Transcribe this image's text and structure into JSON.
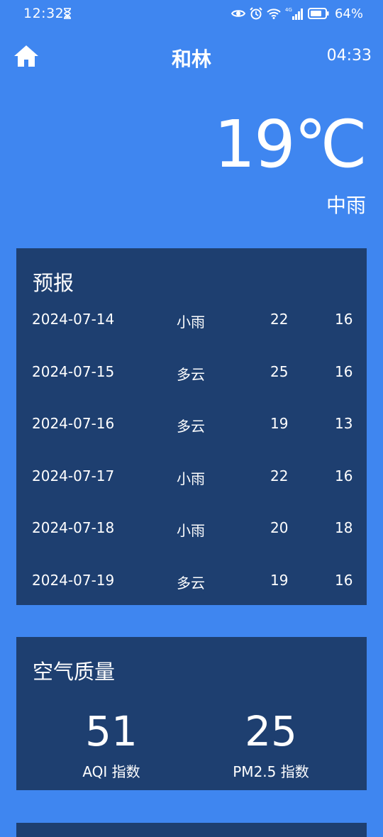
{
  "status_bar": {
    "time": "12:32",
    "battery_percent": "64%",
    "network_label": "4G"
  },
  "header": {
    "city": "和林",
    "update_time": "04:33"
  },
  "current": {
    "temperature": "19℃",
    "condition": "中雨"
  },
  "forecast": {
    "title": "预报",
    "rows": [
      {
        "date": "2024-07-14",
        "condition": "小雨",
        "max": "22",
        "min": "16"
      },
      {
        "date": "2024-07-15",
        "condition": "多云",
        "max": "25",
        "min": "16"
      },
      {
        "date": "2024-07-16",
        "condition": "多云",
        "max": "19",
        "min": "13"
      },
      {
        "date": "2024-07-17",
        "condition": "小雨",
        "max": "22",
        "min": "16"
      },
      {
        "date": "2024-07-18",
        "condition": "小雨",
        "max": "20",
        "min": "18"
      },
      {
        "date": "2024-07-19",
        "condition": "多云",
        "max": "19",
        "min": "16"
      }
    ]
  },
  "air_quality": {
    "title": "空气质量",
    "aqi_value": "51",
    "aqi_label": "AQI 指数",
    "pm25_value": "25",
    "pm25_label": "PM2.5 指数"
  },
  "colors": {
    "background": "#3f86f0",
    "panel": "#1e3f70",
    "text": "#ffffff"
  },
  "icons": [
    "hourglass-icon",
    "eye-icon",
    "alarm-icon",
    "wifi-icon",
    "signal-icon",
    "battery-icon",
    "home-icon"
  ]
}
